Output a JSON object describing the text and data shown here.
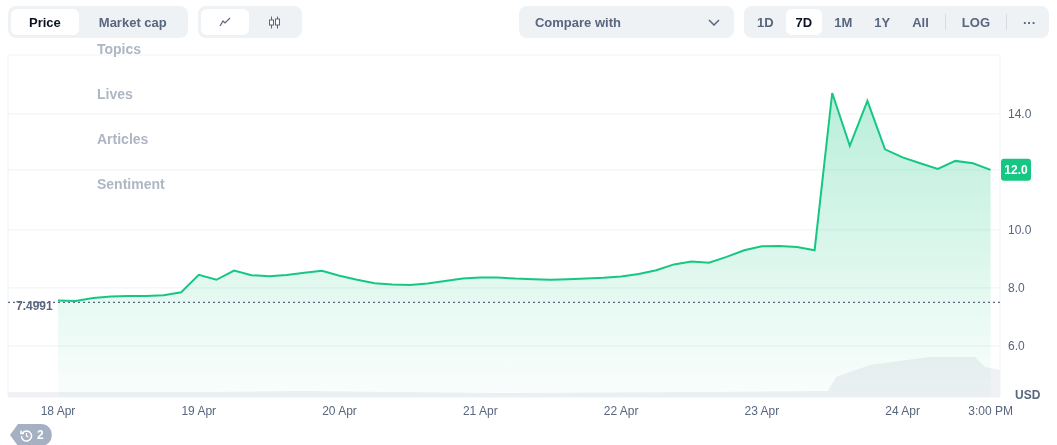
{
  "tabs": [
    {
      "label": "Price",
      "selected": true
    },
    {
      "label": "Market cap",
      "selected": false
    }
  ],
  "chart_types": [
    {
      "kind": "line",
      "selected": true
    },
    {
      "kind": "candles",
      "selected": false
    }
  ],
  "compare": {
    "placeholder": "Compare with"
  },
  "ranges": [
    {
      "label": "1D",
      "selected": false
    },
    {
      "label": "7D",
      "selected": true
    },
    {
      "label": "1M",
      "selected": false
    },
    {
      "label": "1Y",
      "selected": false
    },
    {
      "label": "All",
      "selected": false
    }
  ],
  "log": {
    "label": "LOG"
  },
  "more": {
    "label": "···"
  },
  "overlay_menu": [
    "Topics",
    "Lives",
    "Articles",
    "Sentiment"
  ],
  "chart": {
    "currency": "USD",
    "current_label": "12.0",
    "chart_data": {
      "type": "area",
      "categories": [
        "18 Apr",
        null,
        null,
        null,
        null,
        null,
        null,
        null,
        "19 Apr",
        null,
        null,
        null,
        null,
        null,
        null,
        null,
        "20 Apr",
        null,
        null,
        null,
        null,
        null,
        null,
        null,
        "21 Apr",
        null,
        null,
        null,
        null,
        null,
        null,
        null,
        "22 Apr",
        null,
        null,
        null,
        null,
        null,
        null,
        null,
        "23 Apr",
        null,
        null,
        null,
        null,
        null,
        null,
        null,
        "24 Apr",
        null,
        null,
        null,
        null,
        "3:00 PM"
      ],
      "series": [
        {
          "color": "#16c784",
          "values": [
            7.57,
            7.55,
            7.65,
            7.7,
            7.72,
            7.72,
            7.75,
            7.85,
            8.45,
            8.28,
            8.6,
            8.44,
            8.4,
            8.45,
            8.52,
            8.59,
            8.42,
            8.28,
            8.16,
            8.12,
            8.1,
            8.15,
            8.24,
            8.32,
            8.36,
            8.36,
            8.32,
            8.3,
            8.28,
            8.3,
            8.32,
            8.35,
            8.39,
            8.48,
            8.61,
            8.81,
            8.91,
            8.87,
            9.07,
            9.3,
            9.44,
            9.45,
            9.41,
            9.3,
            14.72,
            12.9,
            14.45,
            12.78,
            12.5,
            12.3,
            12.1,
            12.38,
            12.3,
            12.07
          ]
        }
      ],
      "ref_lines": [
        {
          "axis": "y",
          "value": 7.4991,
          "label": "7.4991"
        }
      ],
      "grid": true,
      "ylim": [
        4.24,
        16.03
      ],
      "yticks": [
        {
          "value": 6,
          "label": "6.0"
        },
        {
          "value": 8,
          "label": "8.0"
        },
        {
          "value": 10,
          "label": "10.0"
        },
        {
          "value": 14,
          "label": "14.0"
        }
      ]
    }
  },
  "history_badge": {
    "count": "2"
  }
}
